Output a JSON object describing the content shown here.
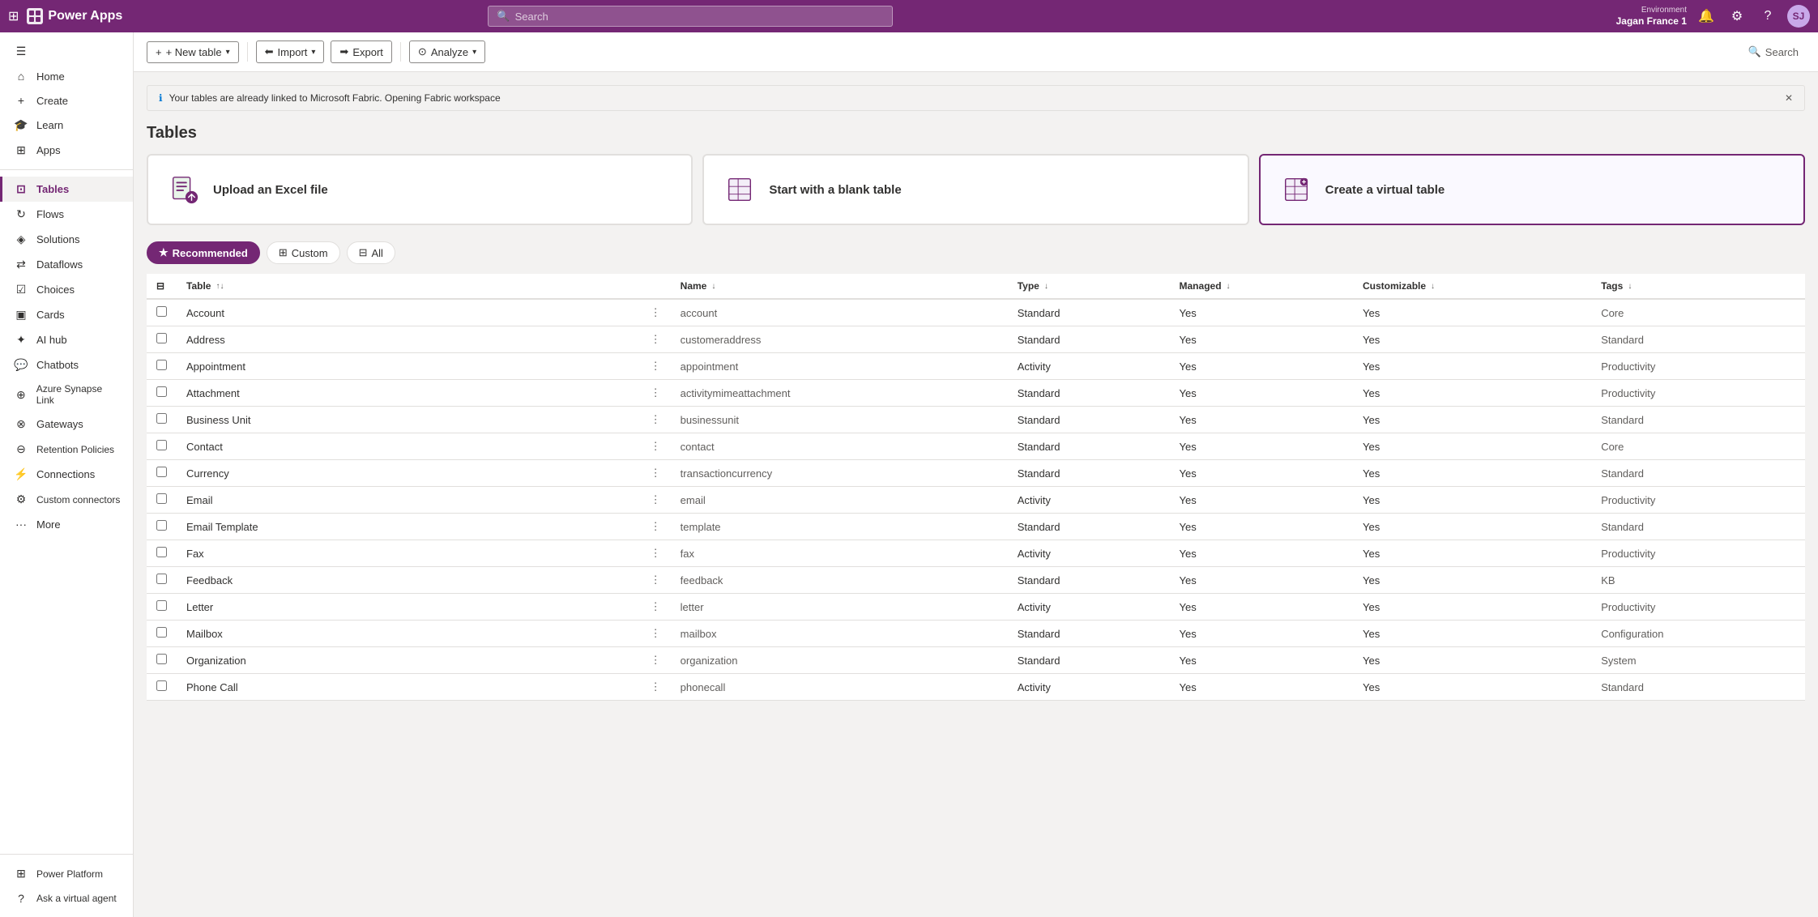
{
  "topbar": {
    "app_name": "Power Apps",
    "search_placeholder": "Search",
    "env_label": "Environment",
    "env_name": "Jagan France 1",
    "avatar_initials": "SJ"
  },
  "sidebar": {
    "items": [
      {
        "id": "collapse",
        "label": "",
        "icon": "☰"
      },
      {
        "id": "home",
        "label": "Home",
        "icon": "⌂"
      },
      {
        "id": "create",
        "label": "Create",
        "icon": "+"
      },
      {
        "id": "learn",
        "label": "Learn",
        "icon": "🎓"
      },
      {
        "id": "apps",
        "label": "Apps",
        "icon": "⊞"
      },
      {
        "id": "tables",
        "label": "Tables",
        "icon": "⊡",
        "active": true
      },
      {
        "id": "flows",
        "label": "Flows",
        "icon": "↻"
      },
      {
        "id": "solutions",
        "label": "Solutions",
        "icon": "◈"
      },
      {
        "id": "dataflows",
        "label": "Dataflows",
        "icon": "⇄"
      },
      {
        "id": "choices",
        "label": "Choices",
        "icon": "☑"
      },
      {
        "id": "cards",
        "label": "Cards",
        "icon": "▣"
      },
      {
        "id": "aihub",
        "label": "AI hub",
        "icon": "✦"
      },
      {
        "id": "chatbots",
        "label": "Chatbots",
        "icon": "💬"
      },
      {
        "id": "azure",
        "label": "Azure Synapse Link",
        "icon": "⊕"
      },
      {
        "id": "gateways",
        "label": "Gateways",
        "icon": "⊗"
      },
      {
        "id": "retention",
        "label": "Retention Policies",
        "icon": "⊖"
      },
      {
        "id": "connections",
        "label": "Connections",
        "icon": "⚡"
      },
      {
        "id": "custom",
        "label": "Custom connectors",
        "icon": "⚙"
      },
      {
        "id": "more",
        "label": "More",
        "icon": "···"
      }
    ],
    "bottom_items": [
      {
        "id": "power-platform",
        "label": "Power Platform",
        "icon": "⊞"
      }
    ],
    "ask_agent": {
      "label": "Ask a virtual agent",
      "icon": "?"
    }
  },
  "subtoolbar": {
    "new_table": "+ New table",
    "import": "⬅ Import",
    "export": "➡ Export",
    "analyze": "⊙ Analyze",
    "search_label": "Search"
  },
  "notif": {
    "message": "Your tables are already linked to Microsoft Fabric. Opening Fabric workspace"
  },
  "page": {
    "title": "Tables"
  },
  "action_cards": [
    {
      "id": "upload-excel",
      "label": "Upload an Excel file",
      "icon_color": "#742774"
    },
    {
      "id": "blank-table",
      "label": "Start with a blank table",
      "icon_color": "#742774"
    },
    {
      "id": "virtual-table",
      "label": "Create a virtual table",
      "icon_color": "#742774",
      "highlighted": true
    }
  ],
  "filter_tabs": [
    {
      "id": "recommended",
      "label": "Recommended",
      "active": true,
      "icon": "★"
    },
    {
      "id": "custom",
      "label": "Custom",
      "active": false,
      "icon": "⊞"
    },
    {
      "id": "all",
      "label": "All",
      "active": false,
      "icon": "⊟"
    }
  ],
  "table": {
    "columns": [
      {
        "id": "check",
        "label": ""
      },
      {
        "id": "table",
        "label": "Table",
        "sortable": true
      },
      {
        "id": "dots",
        "label": ""
      },
      {
        "id": "name",
        "label": "Name",
        "sortable": true
      },
      {
        "id": "type",
        "label": "Type",
        "sortable": true
      },
      {
        "id": "managed",
        "label": "Managed",
        "sortable": true
      },
      {
        "id": "customizable",
        "label": "Customizable",
        "sortable": true
      },
      {
        "id": "tags",
        "label": "Tags",
        "sortable": true
      }
    ],
    "rows": [
      {
        "table": "Account",
        "name": "account",
        "type": "Standard",
        "managed": "Yes",
        "customizable": "Yes",
        "tags": "Core"
      },
      {
        "table": "Address",
        "name": "customeraddress",
        "type": "Standard",
        "managed": "Yes",
        "customizable": "Yes",
        "tags": "Standard"
      },
      {
        "table": "Appointment",
        "name": "appointment",
        "type": "Activity",
        "managed": "Yes",
        "customizable": "Yes",
        "tags": "Productivity"
      },
      {
        "table": "Attachment",
        "name": "activitymimeattachment",
        "type": "Standard",
        "managed": "Yes",
        "customizable": "Yes",
        "tags": "Productivity"
      },
      {
        "table": "Business Unit",
        "name": "businessunit",
        "type": "Standard",
        "managed": "Yes",
        "customizable": "Yes",
        "tags": "Standard"
      },
      {
        "table": "Contact",
        "name": "contact",
        "type": "Standard",
        "managed": "Yes",
        "customizable": "Yes",
        "tags": "Core"
      },
      {
        "table": "Currency",
        "name": "transactioncurrency",
        "type": "Standard",
        "managed": "Yes",
        "customizable": "Yes",
        "tags": "Standard"
      },
      {
        "table": "Email",
        "name": "email",
        "type": "Activity",
        "managed": "Yes",
        "customizable": "Yes",
        "tags": "Productivity"
      },
      {
        "table": "Email Template",
        "name": "template",
        "type": "Standard",
        "managed": "Yes",
        "customizable": "Yes",
        "tags": "Standard"
      },
      {
        "table": "Fax",
        "name": "fax",
        "type": "Activity",
        "managed": "Yes",
        "customizable": "Yes",
        "tags": "Productivity"
      },
      {
        "table": "Feedback",
        "name": "feedback",
        "type": "Standard",
        "managed": "Yes",
        "customizable": "Yes",
        "tags": "KB"
      },
      {
        "table": "Letter",
        "name": "letter",
        "type": "Activity",
        "managed": "Yes",
        "customizable": "Yes",
        "tags": "Productivity"
      },
      {
        "table": "Mailbox",
        "name": "mailbox",
        "type": "Standard",
        "managed": "Yes",
        "customizable": "Yes",
        "tags": "Configuration"
      },
      {
        "table": "Organization",
        "name": "organization",
        "type": "Standard",
        "managed": "Yes",
        "customizable": "Yes",
        "tags": "System"
      },
      {
        "table": "Phone Call",
        "name": "phonecall",
        "type": "Activity",
        "managed": "Yes",
        "customizable": "Yes",
        "tags": "Standard"
      }
    ]
  }
}
